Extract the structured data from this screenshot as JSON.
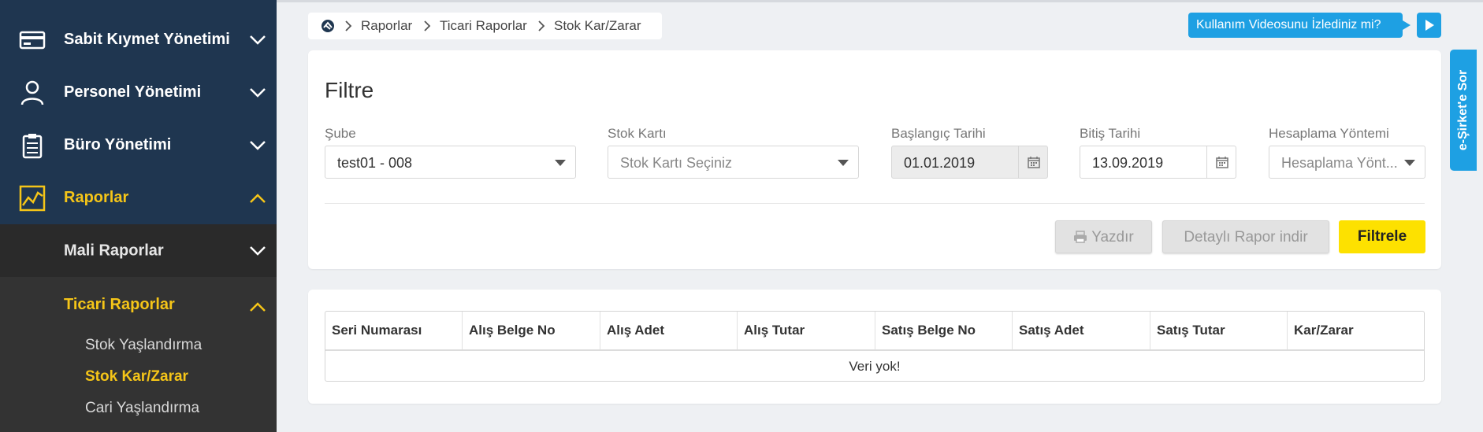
{
  "sidebar": {
    "items": [
      {
        "label": "Sabit Kıymet Yönetimi",
        "icon": "card-icon"
      },
      {
        "label": "Personel Yönetimi",
        "icon": "person-icon"
      },
      {
        "label": "Büro Yönetimi",
        "icon": "clipboard-icon"
      },
      {
        "label": "Raporlar",
        "icon": "chart-icon",
        "active": true
      }
    ],
    "sub": {
      "mali": "Mali Raporlar",
      "ticari": "Ticari Raporlar"
    },
    "leaves": [
      "Stok Yaşlandırma",
      "Stok Kar/Zarar",
      "Cari Yaşlandırma"
    ],
    "active_color": "#f5c518"
  },
  "breadcrumb": [
    "Raporlar",
    "Ticari Raporlar",
    "Stok Kar/Zarar"
  ],
  "video_prompt": "Kullanım Videosunu İzlediniz mi?",
  "side_tab": "e-Şirket'e Sor",
  "filter": {
    "title": "Filtre",
    "sube": {
      "label": "Şube",
      "value": "test01 - 008"
    },
    "stok_karti": {
      "label": "Stok Kartı",
      "placeholder": "Stok Kartı Seçiniz"
    },
    "baslangic": {
      "label": "Başlangıç Tarihi",
      "value": "01.01.2019"
    },
    "bitis": {
      "label": "Bitiş Tarihi",
      "value": "13.09.2019"
    },
    "yontem": {
      "label": "Hesaplama Yöntemi",
      "placeholder": "Hesaplama Yönt..."
    },
    "buttons": {
      "print": "Yazdır",
      "download": "Detaylı Rapor indir",
      "filter": "Filtrele"
    }
  },
  "table": {
    "columns": [
      "Seri Numarası",
      "Alış Belge No",
      "Alış Adet",
      "Alış Tutar",
      "Satış Belge No",
      "Satış Adet",
      "Satış Tutar",
      "Kar/Zarar"
    ],
    "empty": "Veri yok!"
  },
  "colors": {
    "accent": "#fde100",
    "info": "#1ea0e3",
    "sidebar": "#1f3650"
  }
}
